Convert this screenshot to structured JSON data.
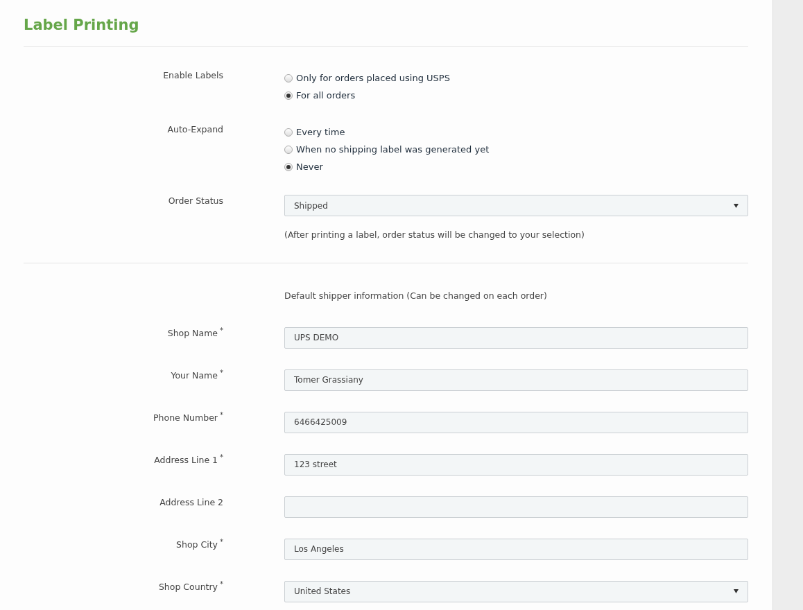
{
  "title": "Label Printing",
  "settings": [
    {
      "kind": "radio",
      "label": "Enable Labels",
      "options": [
        {
          "label": "Only for orders placed using USPS",
          "selected": false
        },
        {
          "label": "For all orders",
          "selected": true
        }
      ]
    },
    {
      "kind": "radio",
      "label": "Auto-Expand",
      "options": [
        {
          "label": "Every time",
          "selected": false
        },
        {
          "label": "When no shipping label was generated yet",
          "selected": false
        },
        {
          "label": "Never",
          "selected": true
        }
      ]
    },
    {
      "kind": "select",
      "label": "Order Status",
      "value": "Shipped",
      "note": "(After printing a label, order status will be changed to your selection)"
    }
  ],
  "shipper": {
    "intro": "Default shipper information (Can be changed on each order)",
    "fields": [
      {
        "kind": "text",
        "label": "Shop Name",
        "marker": "*",
        "value": "UPS DEMO"
      },
      {
        "kind": "text",
        "label": "Your Name",
        "marker": "*",
        "value": "Tomer Grassiany"
      },
      {
        "kind": "text",
        "label": "Phone Number",
        "marker": "*",
        "value": "6466425009"
      },
      {
        "kind": "text",
        "label": "Address Line 1",
        "marker": "*",
        "value": "123 street"
      },
      {
        "kind": "text",
        "label": "Address Line 2"
      },
      {
        "kind": "text",
        "label": "Shop City",
        "marker": "*",
        "value": "Los Angeles"
      },
      {
        "kind": "select",
        "label": "Shop Country",
        "marker": "*",
        "value": "United States"
      }
    ]
  }
}
